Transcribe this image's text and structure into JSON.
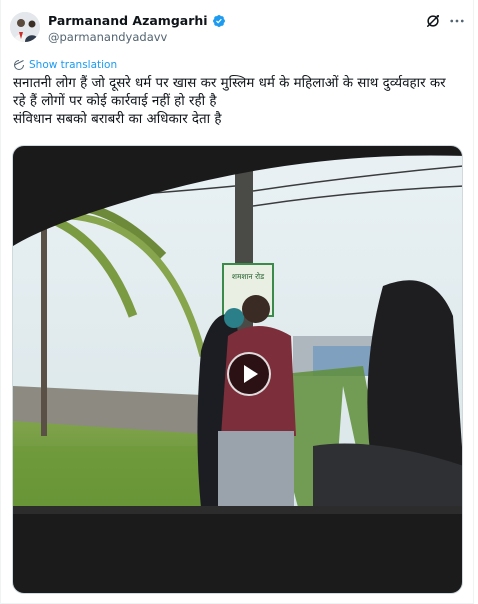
{
  "tweet": {
    "author": {
      "display_name": "Parmanand Azamgarhi",
      "handle": "@parmanandyadavv",
      "verified": true,
      "verified_color": "#1d9bf0"
    },
    "text_lines": [
      "सनातनी लोग हैं जो दूसरे धर्म पर खास कर मुस्लिम धर्म के महिलाओं के साथ दुर्व्यवहार कर",
      "रहे हैं लोगों पर कोई कार्रवाई नहीं हो रही है",
      "संविधान सबको बराबरी का अधिकार देता है"
    ],
    "show_translation_label": "Show translation",
    "accent_color": "#1d9bf0",
    "media": {
      "type": "video",
      "sign_text": "शमशान रोड"
    },
    "icons": {
      "grok": "grok-icon",
      "more": "more-icon",
      "translate": "translate-icon",
      "play": "play-icon",
      "verified": "verified-badge-icon"
    }
  }
}
